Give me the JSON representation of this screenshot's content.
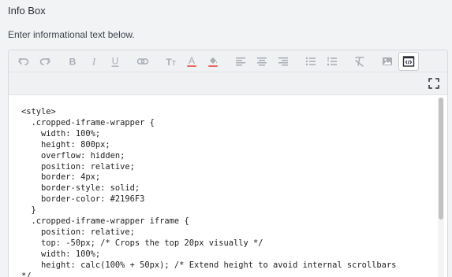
{
  "field": {
    "title": "Info Box",
    "helper_text": "Enter informational text below."
  },
  "toolbar": {
    "buttons": [
      {
        "icon": "undo-icon"
      },
      {
        "icon": "redo-icon"
      },
      {
        "icon": "bold-icon"
      },
      {
        "icon": "italic-icon"
      },
      {
        "icon": "underline-icon"
      },
      {
        "icon": "link-icon"
      },
      {
        "icon": "font-size-icon"
      },
      {
        "icon": "font-color-icon"
      },
      {
        "icon": "highlight-color-icon"
      },
      {
        "icon": "align-left-icon"
      },
      {
        "icon": "align-center-icon"
      },
      {
        "icon": "align-right-icon"
      },
      {
        "icon": "bulleted-list-icon"
      },
      {
        "icon": "numbered-list-icon"
      },
      {
        "icon": "clear-formatting-icon"
      },
      {
        "icon": "image-icon"
      },
      {
        "icon": "source-code-icon",
        "active": true
      }
    ],
    "fullscreen_icon": "fullscreen-icon"
  },
  "colors": {
    "icon_muted": "#a9adb4",
    "icon_active": "#2b2f36",
    "font_color_bar": "#e46a6a",
    "highlight_bar": "#e46a6a"
  },
  "editor": {
    "code": "<style>\n  .cropped-iframe-wrapper {\n    width: 100%;\n    height: 800px;\n    overflow: hidden;\n    position: relative;\n    border: 4px;\n    border-style: solid;\n    border-color: #2196F3\n  }\n  .cropped-iframe-wrapper iframe {\n    position: relative;\n    top: -50px; /* Crops the top 20px visually */\n    width: 100%;\n    height: calc(100% + 50px); /* Extend height to avoid internal scrollbars\n*/"
  }
}
